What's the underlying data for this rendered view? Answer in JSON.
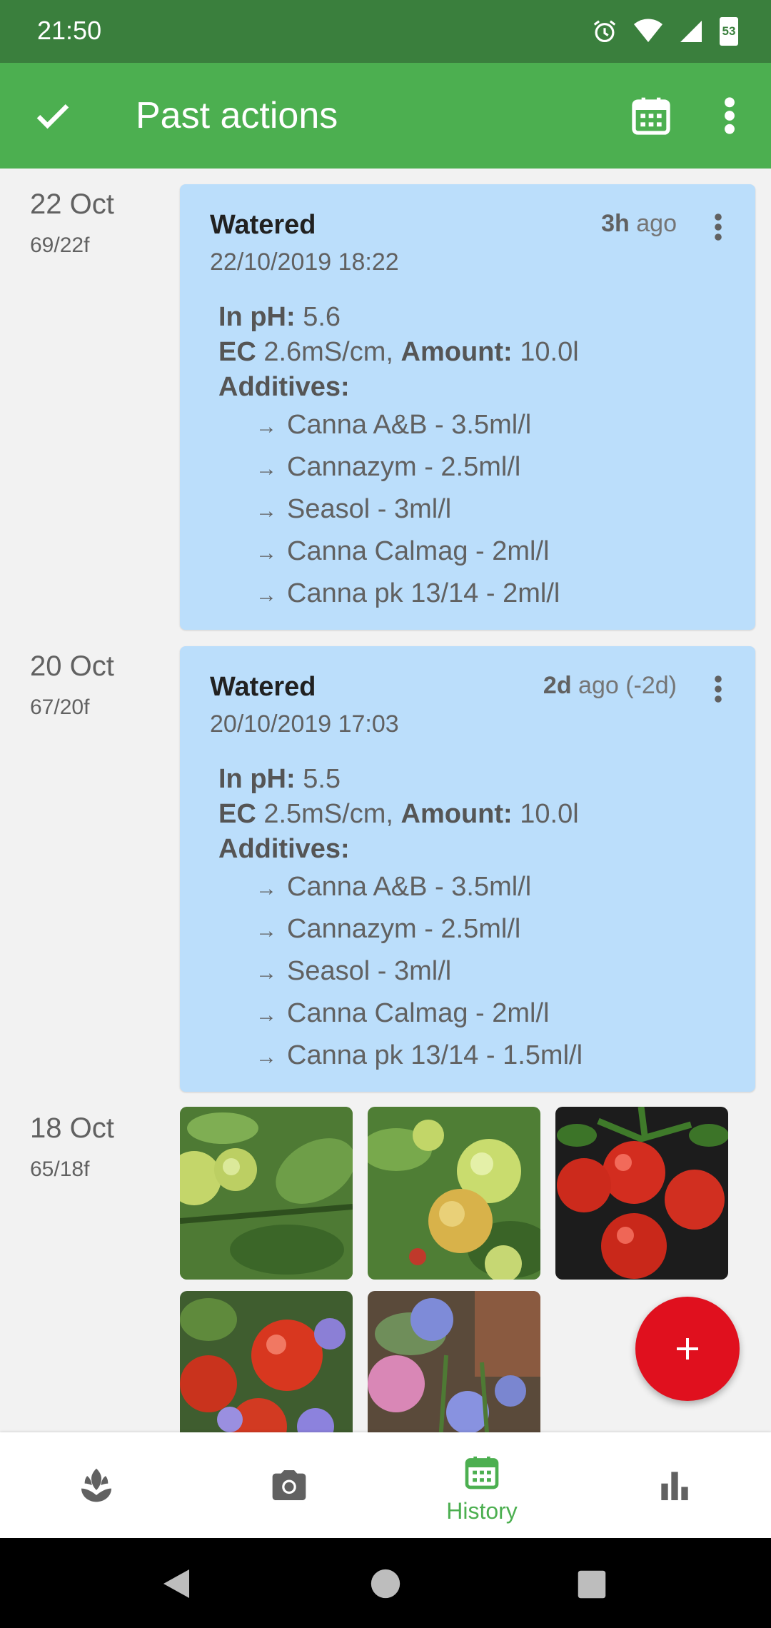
{
  "status_bar": {
    "time": "21:50",
    "battery": "53"
  },
  "app_bar": {
    "title": "Past actions"
  },
  "colors": {
    "primary": "#4caf50",
    "status": "#3a7f3d",
    "card": "#bbdefb",
    "fab": "#e0101e"
  },
  "entries": [
    {
      "date": "22 Oct",
      "temp": "69/22f",
      "type": "Watered",
      "datetime": "22/10/2019 18:22",
      "ago_bold": "3h",
      "ago_rest": " ago",
      "ph_label": "In pH:",
      "ph_value": " 5.6",
      "ec_label": "EC",
      "ec_value": " 2.6mS/cm, ",
      "amount_label": "Amount:",
      "amount_value": " 10.0l",
      "additives_label": "Additives:",
      "additives": [
        "Canna A&B - 3.5ml/l",
        "Cannazym - 2.5ml/l",
        "Seasol - 3ml/l",
        "Canna Calmag - 2ml/l",
        "Canna pk 13/14 - 2ml/l"
      ]
    },
    {
      "date": "20 Oct",
      "temp": "67/20f",
      "type": "Watered",
      "datetime": "20/10/2019 17:03",
      "ago_bold": "2d",
      "ago_rest": " ago (-2d)",
      "ph_label": "In pH:",
      "ph_value": " 5.5",
      "ec_label": "EC",
      "ec_value": " 2.5mS/cm, ",
      "amount_label": "Amount:",
      "amount_value": " 10.0l",
      "additives_label": "Additives:",
      "additives": [
        "Canna A&B - 3.5ml/l",
        "Cannazym - 2.5ml/l",
        "Seasol - 3ml/l",
        "Canna Calmag - 2ml/l",
        "Canna pk 13/14 - 1.5ml/l"
      ]
    },
    {
      "date": "18 Oct",
      "temp": "65/18f"
    }
  ],
  "arrow": "→",
  "bottom_nav": {
    "active_label": "History"
  }
}
